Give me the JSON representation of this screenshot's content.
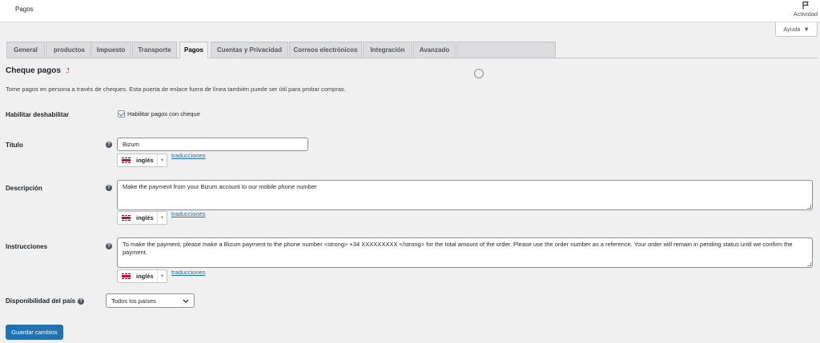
{
  "topbar": {
    "title": "Pagos",
    "activity_label": "Actividad"
  },
  "help_button": {
    "label": "Ayuda"
  },
  "tabs": [
    {
      "label": "General"
    },
    {
      "label": "productos"
    },
    {
      "label": "Impuesto"
    },
    {
      "label": "Transporte"
    },
    {
      "label": "Pagos",
      "active": true
    },
    {
      "label": "Cuentas y Privacidad"
    },
    {
      "label": "Correos electrónicos"
    },
    {
      "label": "Integración"
    },
    {
      "label": "Avanzado"
    }
  ],
  "section": {
    "title": "Cheque pagos",
    "title_link": "⮥",
    "description": "Tome pagos en persona a través de cheques. Esta puerta de enlace fuera de línea también puede ser útil para probar compras."
  },
  "fields": {
    "enable": {
      "label": "Habilitar deshabilitar",
      "checkbox_label": "Habilitar pagos con cheque",
      "checked": true
    },
    "title": {
      "label": "Título",
      "value": "Bizum"
    },
    "description": {
      "label": "Descripción",
      "value": "Make the payment from your Bizum account to our mobile phone number"
    },
    "instructions": {
      "label": "Instrucciones",
      "value": "To make the payment, please make a Bizum payment to the phone number <strong> +34 XXXXXXXXX </strong> for the total amount of the order. Please use the order number as a reference. Your order will remain in pending status until we confirm the payment."
    },
    "country": {
      "label": "Disponibilidad del país",
      "selected": "Todos los países"
    }
  },
  "language": {
    "name": "inglés",
    "translations_link": "traducciones"
  },
  "save_button": {
    "label": "Guardar cambios"
  },
  "colors": {
    "primary": "#2271b1",
    "background": "#f0f0f1"
  }
}
